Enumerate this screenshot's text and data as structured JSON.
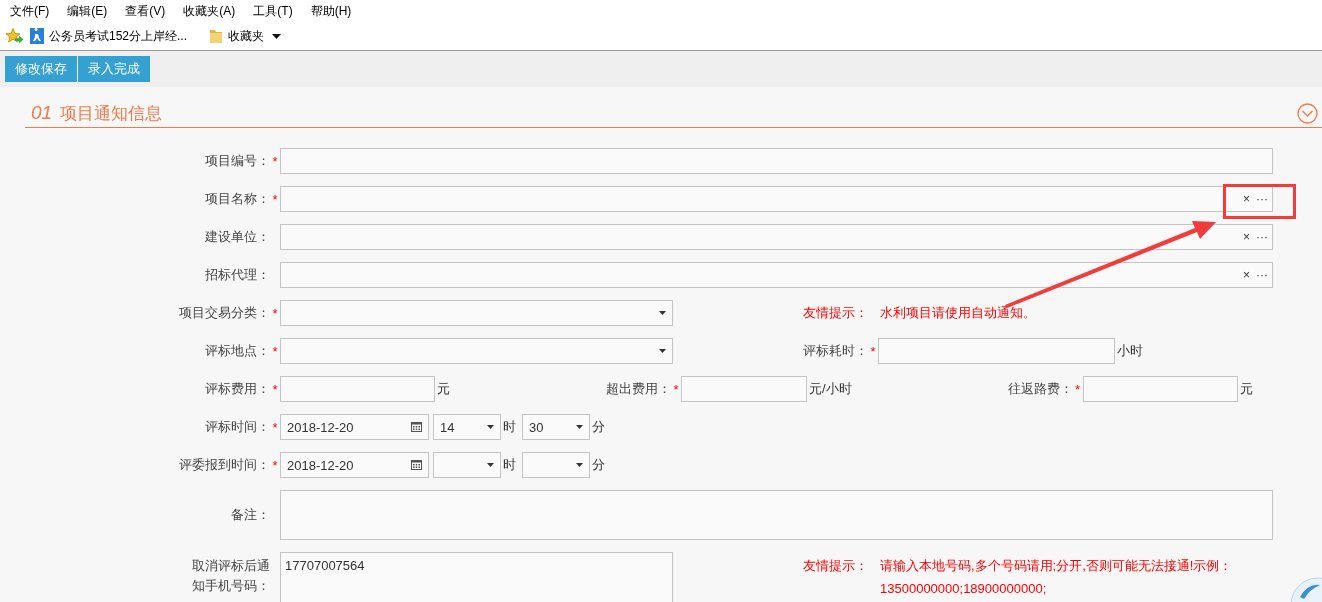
{
  "menu": [
    {
      "label": "文件(F)"
    },
    {
      "label": "编辑(E)"
    },
    {
      "label": "查看(V)"
    },
    {
      "label": "收藏夹(A)"
    },
    {
      "label": "工具(T)"
    },
    {
      "label": "帮助(H)"
    }
  ],
  "favorites": [
    {
      "kind": "link",
      "label": "公务员考试152分上岸经..."
    },
    {
      "kind": "folder",
      "label": "收藏夹"
    }
  ],
  "toolbar": [
    {
      "label": "修改保存"
    },
    {
      "label": "录入完成"
    }
  ],
  "section": {
    "number": "01",
    "title": "项目通知信息"
  },
  "rows": [
    {
      "kind": "full",
      "fields": [
        {
          "kind": "text",
          "label": "项目编号：",
          "required_mark": "*"
        }
      ]
    },
    {
      "kind": "full",
      "fields": [
        {
          "kind": "picker",
          "label": "项目名称：",
          "required_mark": "*",
          "clear": "×",
          "more": "···"
        }
      ]
    },
    {
      "kind": "full",
      "fields": [
        {
          "kind": "picker",
          "label": "建设单位：",
          "clear": "×",
          "more": "···"
        }
      ]
    },
    {
      "kind": "full",
      "fields": [
        {
          "kind": "picker",
          "label": "招标代理：",
          "clear": "×",
          "more": "···"
        }
      ]
    },
    {
      "kind": "half",
      "fields": [
        {
          "kind": "select",
          "label": "项目交易分类：",
          "required_mark": "*"
        },
        {
          "kind": "hint",
          "label": "友情提示：",
          "lines": [
            "水利项目请使用自动通知。"
          ]
        }
      ]
    },
    {
      "kind": "half",
      "fields": [
        {
          "kind": "select",
          "label": "评标地点：",
          "required_mark": "*"
        },
        {
          "kind": "text",
          "label": "评标耗时：",
          "required_mark": "*",
          "unit": "小时"
        }
      ]
    },
    {
      "kind": "triple",
      "fields": [
        {
          "kind": "text",
          "label": "评标费用：",
          "required_mark": "*",
          "unit": "元"
        },
        {
          "kind": "text",
          "label": "超出费用：",
          "required_mark": "*",
          "unit": "元/小时"
        },
        {
          "kind": "text",
          "label": "往返路费：",
          "required_mark": "*",
          "unit": "元"
        }
      ]
    },
    {
      "kind": "time",
      "fields": [
        {
          "kind": "datetime",
          "label": "评标时间：",
          "required_mark": "*",
          "date": "2018-12-20",
          "hour": "14",
          "hour_unit": "时",
          "minute": "30",
          "minute_unit": "分"
        }
      ]
    },
    {
      "kind": "time",
      "fields": [
        {
          "kind": "datetime",
          "label": "评委报到时间：",
          "required_mark": "*",
          "date": "2018-12-20",
          "hour_unit": "时",
          "minute_unit": "分"
        }
      ]
    },
    {
      "kind": "note",
      "fields": [
        {
          "kind": "textarea",
          "label": "备注："
        }
      ]
    },
    {
      "kind": "phone",
      "fields": [
        {
          "kind": "textarea",
          "label": "取消评标后通知手机号码：",
          "value": "17707007564"
        },
        {
          "kind": "hint",
          "label": "友情提示：",
          "lines": [
            "请输入本地号码,多个号码请用;分开,否则可能无法接通!示例：",
            "13500000000;18900000000;"
          ]
        }
      ]
    }
  ]
}
